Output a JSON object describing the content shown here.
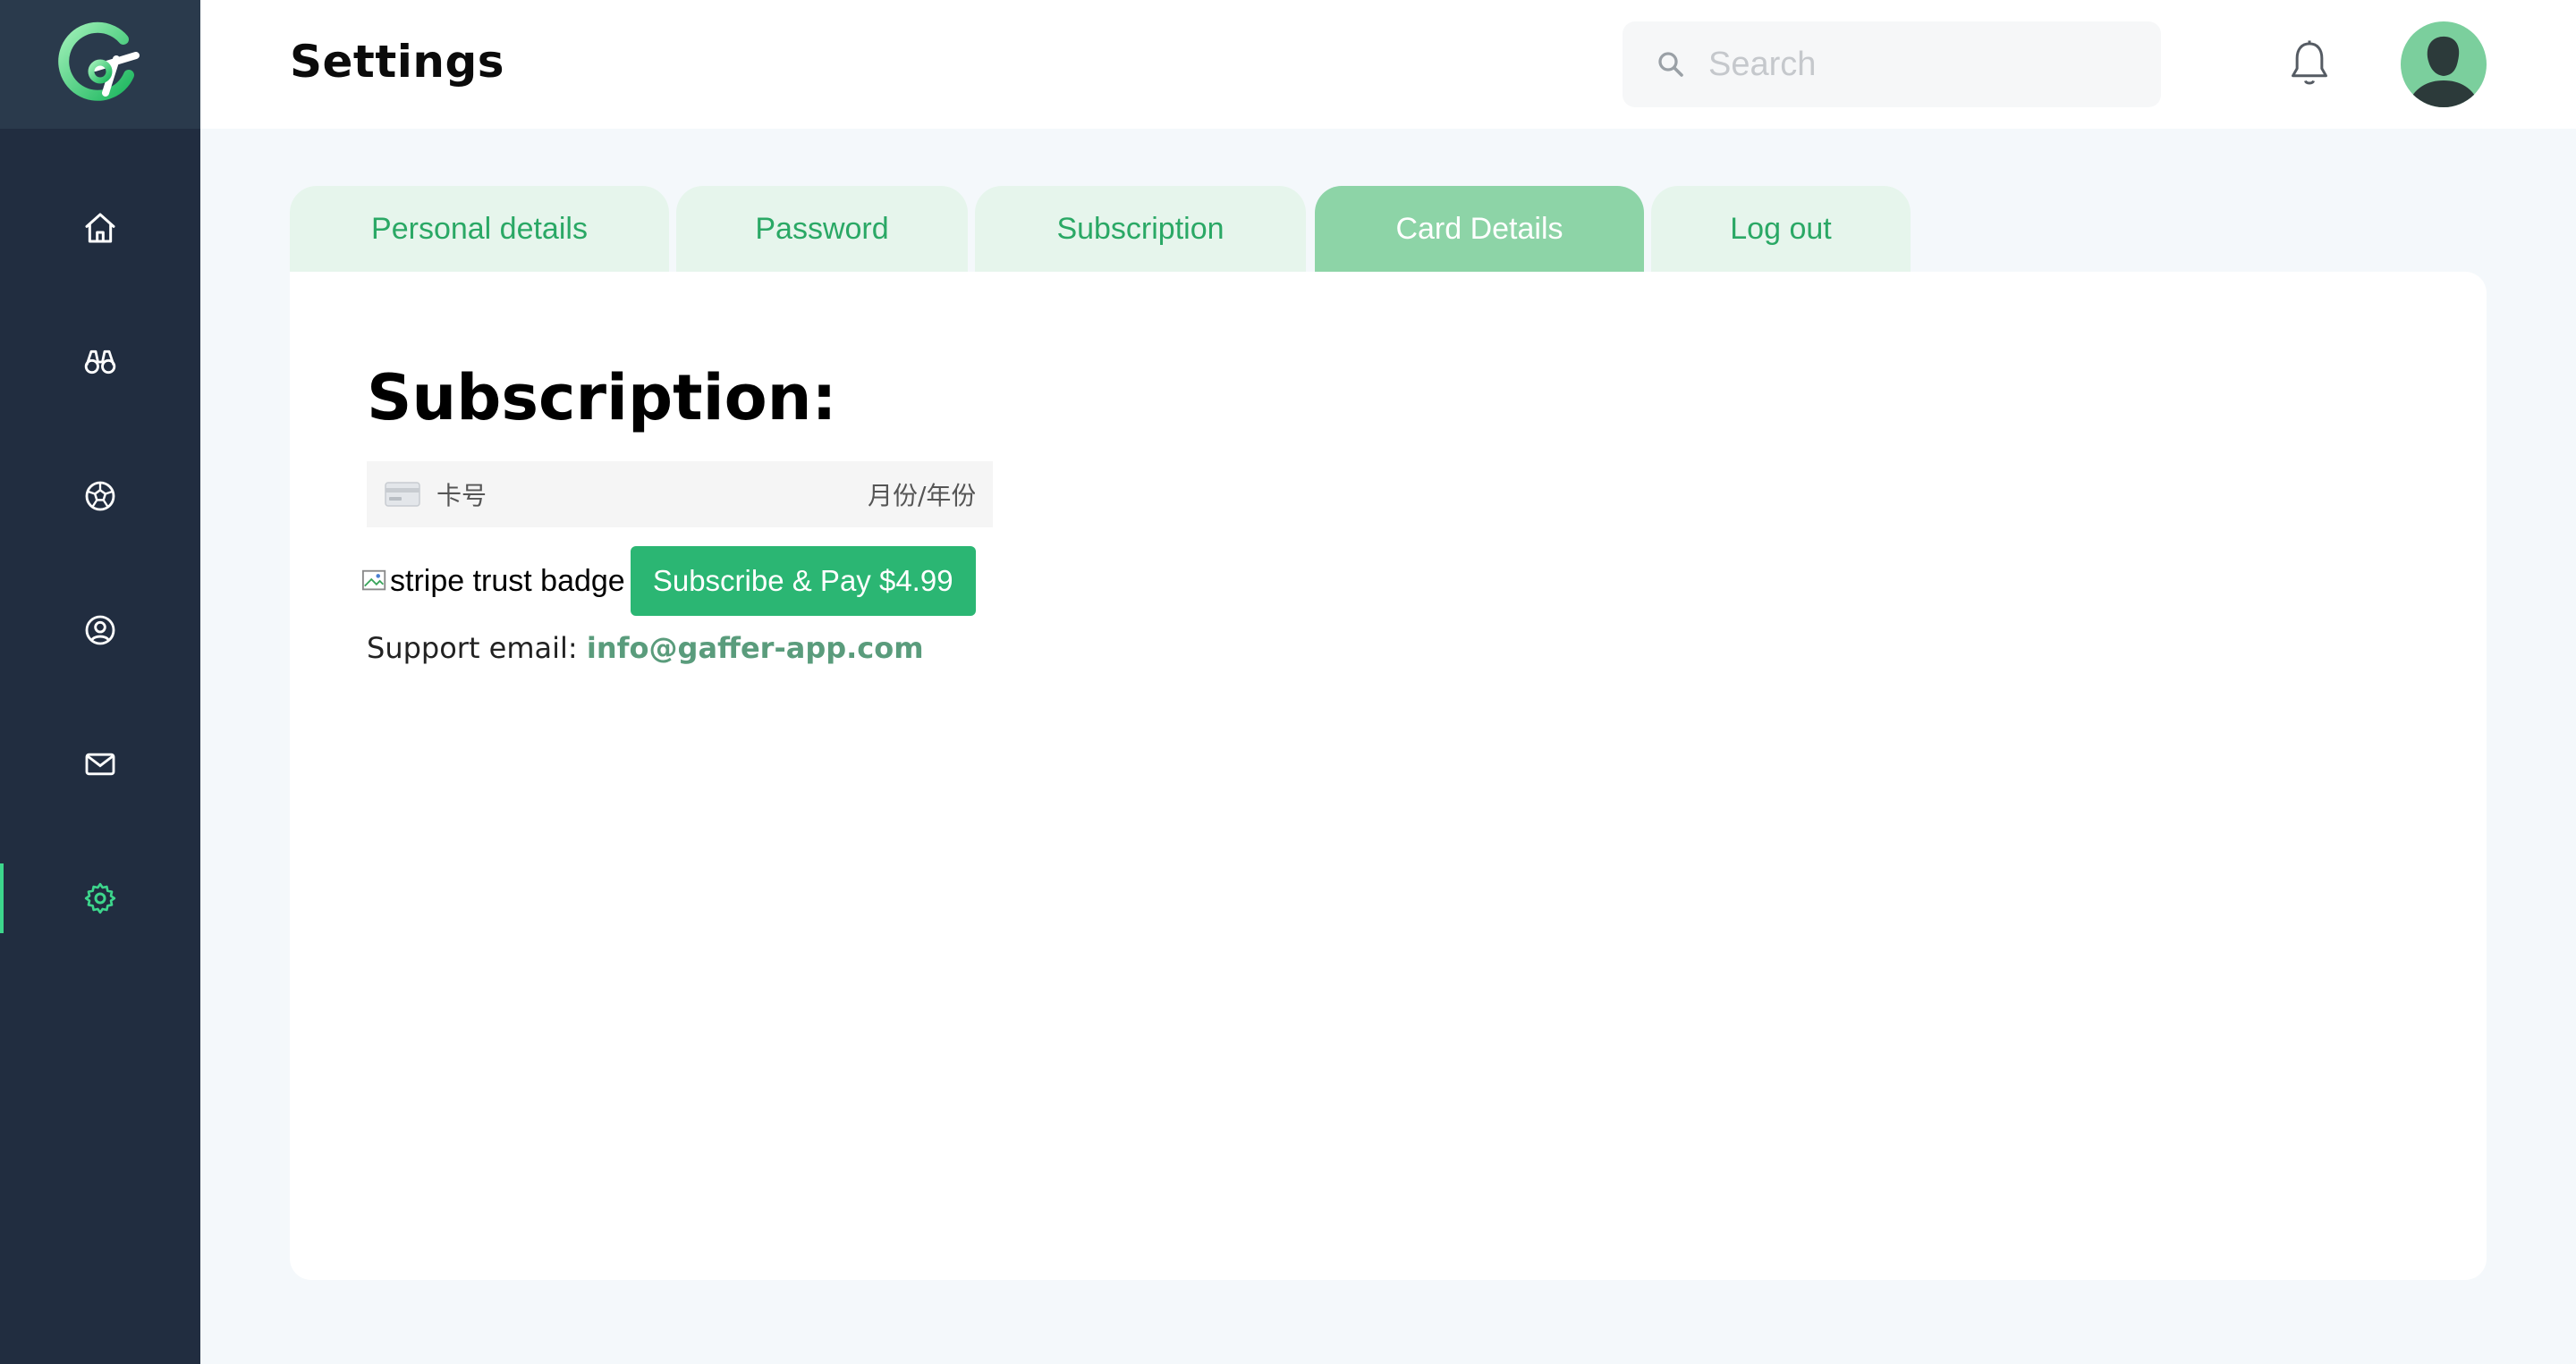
{
  "header": {
    "title": "Settings",
    "search_placeholder": "Search"
  },
  "sidebar": {
    "items": [
      {
        "icon": "home-icon"
      },
      {
        "icon": "binoculars-icon"
      },
      {
        "icon": "soccer-ball-icon"
      },
      {
        "icon": "user-circle-icon"
      },
      {
        "icon": "mail-icon"
      },
      {
        "icon": "gear-icon",
        "active": true
      }
    ]
  },
  "tabs": [
    {
      "label": "Personal details"
    },
    {
      "label": "Password"
    },
    {
      "label": "Subscription"
    },
    {
      "label": "Card Details",
      "active": true
    },
    {
      "label": "Log out"
    }
  ],
  "content": {
    "title": "Subscription:",
    "card_number_placeholder": "卡号",
    "expiry_placeholder": "月份/年份",
    "badge_alt": "stripe trust badge",
    "pay_button": "Subscribe & Pay $4.99",
    "support_label": "Support email: ",
    "support_email": "info@gaffer-app.com"
  },
  "colors": {
    "sidebar": "#212d40",
    "accent": "#2bb673",
    "tab_active": "#8dd4a7",
    "tab_inactive": "#e6f5ec"
  }
}
